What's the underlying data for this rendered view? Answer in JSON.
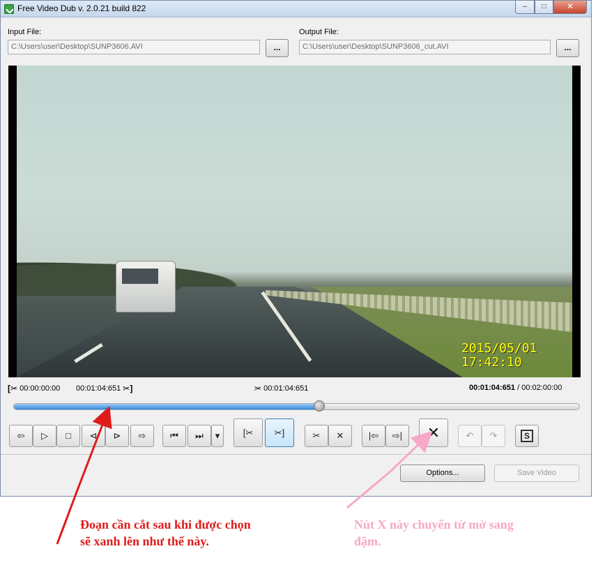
{
  "window": {
    "title": "Free Video Dub  v. 2.0.21 build 822",
    "min_glyph": "–",
    "max_glyph": "□",
    "close_glyph": "✕"
  },
  "input": {
    "label": "Input File:",
    "path": "C:\\Users\\user\\Desktop\\SUNP3606.AVI",
    "browse_label": "..."
  },
  "output": {
    "label": "Output File:",
    "path": "C:\\Users\\user\\Desktop\\SUNP3606_cut.AVI",
    "browse_label": "..."
  },
  "video": {
    "date_stamp": "2015/05/01",
    "time_stamp": "17:42:10"
  },
  "times": {
    "selection_start": "00:00:00:00",
    "selection_end": "00:01:04:651",
    "marker": "00:01:04:651",
    "current": "00:01:04:651",
    "separator": "/",
    "total": "00:02:00:00"
  },
  "timeline": {
    "position_fraction": 0.54
  },
  "controls": {
    "prev_frame": "⇦",
    "play": "▷",
    "stop": "□",
    "prev_key": "⊲",
    "next_key": "⊳",
    "next_frame": "⇨",
    "seek_start": "⏮",
    "seek_end": "⏭",
    "seek_dropdown": "▾",
    "mark_start": "[✂",
    "mark_end": "✂]",
    "mark_cut": "✂",
    "clear_cut": "✕",
    "go_start": "|⇦",
    "go_end": "⇨|",
    "delete_selection": "✕",
    "undo": "↶",
    "redo": "↷",
    "save_frame": "S"
  },
  "actions": {
    "options": "Options...",
    "save_video": "Save Video"
  },
  "annotations": {
    "red_note": "Đoạn cần cắt sau khi được chọn sẽ xanh lên như thế này.",
    "pink_note": "Nút X này chuyển từ mờ sang đậm.",
    "red_color": "#e01b1b",
    "pink_color": "#f7a8c6"
  }
}
